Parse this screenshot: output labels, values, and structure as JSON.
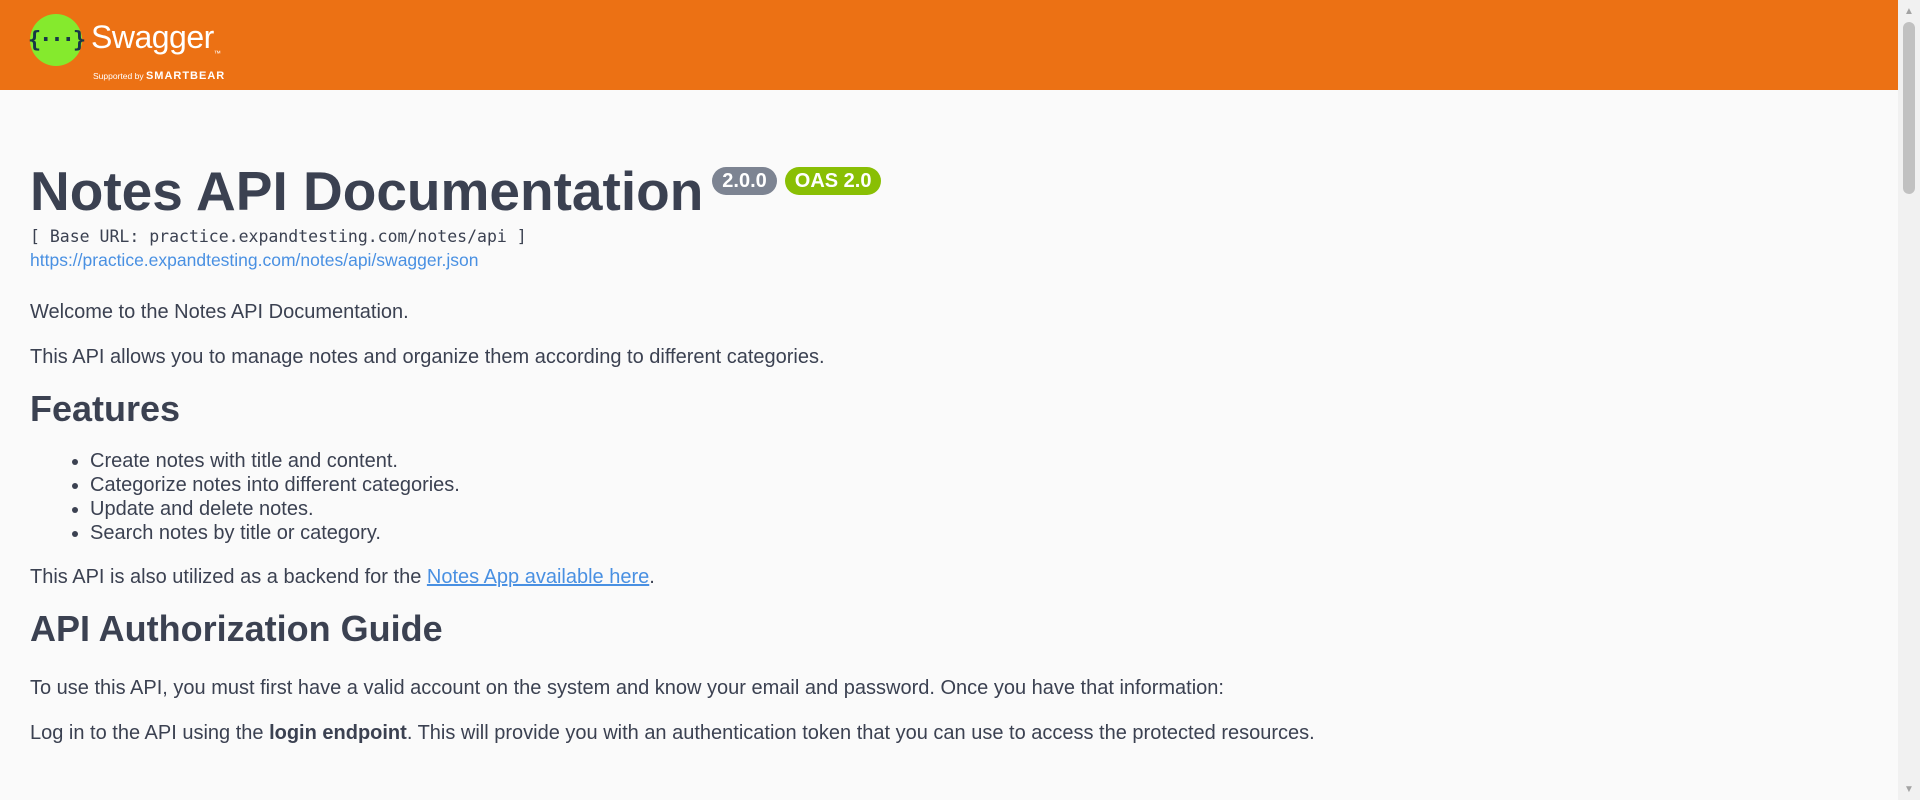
{
  "header": {
    "logo_glyph": "{···}",
    "brand_name": "Swagger",
    "brand_tm": "™",
    "supported_by": "Supported by",
    "supporter": "SMARTBEAR",
    "color": "#ec7114",
    "logo_color": "#85ea2d"
  },
  "info": {
    "title": "Notes API Documentation",
    "version_badge": "2.0.0",
    "oas_badge": "OAS 2.0",
    "base_url": "[ Base URL: practice.expandtesting.com/notes/api ]",
    "spec_url": "https://practice.expandtesting.com/notes/api/swagger.json"
  },
  "description": {
    "welcome": "Welcome to the Notes API Documentation.",
    "intro": "This API allows you to manage notes and organize them according to different categories.",
    "features_heading": "Features",
    "features": [
      "Create notes with title and content.",
      "Categorize notes into different categories.",
      "Update and delete notes.",
      "Search notes by title or category."
    ],
    "backend_prefix": "This API is also utilized as a backend for the ",
    "backend_link": "Notes App available here",
    "backend_suffix": ".",
    "auth_heading": "API Authorization Guide",
    "auth_intro": "To use this API, you must first have a valid account on the system and know your email and password. Once you have that information:",
    "login_prefix": "Log in to the API using the ",
    "login_bold": "login endpoint",
    "login_suffix": ". This will provide you with an authentication token that you can use to access the protected resources."
  },
  "scrollbar": {
    "up_icon": "triangle-up-icon",
    "down_icon": "triangle-down-icon"
  }
}
